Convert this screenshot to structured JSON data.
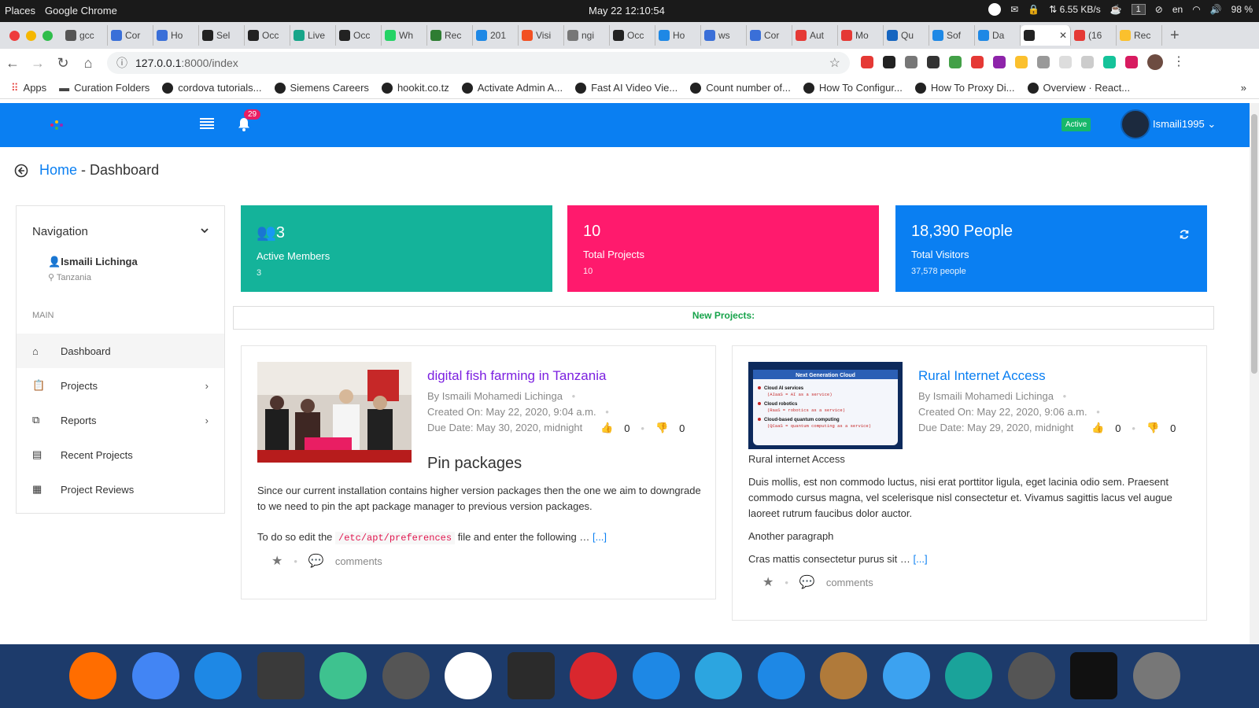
{
  "os": {
    "places": "Places",
    "app": "Google Chrome",
    "clock": "May 22  12:10:54",
    "net": "⇅ 6.55 KB/s",
    "workspace": "1",
    "lang": "en",
    "battery": "98 %"
  },
  "tabs": [
    {
      "label": "gcc",
      "color": "#555"
    },
    {
      "label": "Cor",
      "color": "#3a6fd8"
    },
    {
      "label": "Ho",
      "color": "#3a6fd8"
    },
    {
      "label": "Sel",
      "color": "#222"
    },
    {
      "label": "Occ",
      "color": "#222"
    },
    {
      "label": "Live",
      "color": "#17a589"
    },
    {
      "label": "Occ",
      "color": "#222"
    },
    {
      "label": "Wh",
      "color": "#25d366"
    },
    {
      "label": "Rec",
      "color": "#2e7d32"
    },
    {
      "label": "201",
      "color": "#1e88e5"
    },
    {
      "label": "Visi",
      "color": "#f25022"
    },
    {
      "label": "ngi",
      "color": "#777"
    },
    {
      "label": "Occ",
      "color": "#222"
    },
    {
      "label": "Ho",
      "color": "#1e88e5"
    },
    {
      "label": "ws",
      "color": "#3a6fd8"
    },
    {
      "label": "Cor",
      "color": "#3a6fd8"
    },
    {
      "label": "Aut",
      "color": "#e53935"
    },
    {
      "label": "Mo",
      "color": "#e53935"
    },
    {
      "label": "Qu",
      "color": "#1565c0"
    },
    {
      "label": "Sof",
      "color": "#1e88e5"
    },
    {
      "label": "Da",
      "color": "#1e88e5"
    },
    {
      "label": "",
      "color": "#222",
      "active": true
    },
    {
      "label": "(16",
      "color": "#e53935"
    },
    {
      "label": "Rec",
      "color": "#fbc02d"
    }
  ],
  "address": {
    "host": "127.0.0.1",
    "path": ":8000/index"
  },
  "bookmarks": [
    {
      "label": "Apps"
    },
    {
      "label": "Curation Folders"
    },
    {
      "label": "cordova tutorials..."
    },
    {
      "label": "Siemens Careers"
    },
    {
      "label": "hookit.co.tz"
    },
    {
      "label": "Activate Admin A..."
    },
    {
      "label": "Fast AI Video Vie..."
    },
    {
      "label": "Count number of..."
    },
    {
      "label": "How To Configur..."
    },
    {
      "label": "How To Proxy Di..."
    },
    {
      "label": "Overview · React..."
    }
  ],
  "header": {
    "notifications": "29",
    "status": "Active",
    "username": "Ismaili1995"
  },
  "breadcrumb": {
    "home": "Home",
    "sep": " - ",
    "current": "Dashboard"
  },
  "sidebar": {
    "title": "Navigation",
    "user": "Ismaili Lichinga",
    "location": "Tanzania",
    "section": "MAIN",
    "items": [
      {
        "label": "Dashboard"
      },
      {
        "label": "Projects"
      },
      {
        "label": "Reports"
      },
      {
        "label": "Recent Projects"
      },
      {
        "label": "Project Reviews"
      }
    ]
  },
  "stats": [
    {
      "value": "3",
      "label": "Active Members",
      "sub": "3",
      "color": "#14b39a"
    },
    {
      "value": "10",
      "label": "Total Projects",
      "sub": "10",
      "color": "#ff1a6d"
    },
    {
      "value": "18,390 People",
      "label": "Total Visitors",
      "sub": "37,578 people",
      "color": "#0a7ff2"
    }
  ],
  "new_projects_label": "New Projects:",
  "posts": [
    {
      "title": "digital fish farming in Tanzania",
      "author": "By Ismaili Mohamedi Lichinga",
      "created": "Created On: May 22, 2020, 9:04 a.m.",
      "due": "Due Date: May 30, 2020, midnight",
      "likes": "0",
      "dislikes": "0",
      "heading": "Pin packages",
      "para1": "Since our current installation contains higher version packages then the one we aim to downgrade to we need to pin the apt package manager to previous version packages.",
      "para2_a": "To do so edit the",
      "code": "/etc/apt/preferences",
      "para2_b": "file and enter the following …",
      "more": "[...]",
      "comments": "comments"
    },
    {
      "title": "Rural Internet Access",
      "author": "By Ismaili Mohamedi Lichinga",
      "created": "Created On: May 22, 2020, 9:06 a.m.",
      "due": "Due Date: May 29, 2020, midnight",
      "likes": "0",
      "dislikes": "0",
      "caption": "Rural internet Access",
      "para1": "Duis mollis, est non commodo luctus, nisi erat porttitor ligula, eget lacinia odio sem. Praesent commodo cursus magna, vel scelerisque nisl consectetur et. Vivamus sagittis lacus vel augue laoreet rutrum faucibus dolor auctor.",
      "para2": "Another paragraph",
      "para3": "Cras mattis consectetur purus sit …",
      "more": "[...]",
      "comments": "comments",
      "image_text": {
        "title": "Next Generation Cloud",
        "l1": "Cloud AI services",
        "l1b": "(AIaaS = AI as a service)",
        "l2": "Cloud robotics",
        "l2b": "(RaaS = robotics as a service)",
        "l3": "Cloud-based quantum computing",
        "l3b": "(QCaaS = quantum computing as a service)"
      }
    }
  ],
  "dock": [
    {
      "name": "firefox",
      "color": "#ff6d00"
    },
    {
      "name": "chrome",
      "color": "#4285f4"
    },
    {
      "name": "vscode",
      "color": "#1e88e5"
    },
    {
      "name": "sublime",
      "color": "#3a3a3a"
    },
    {
      "name": "atom",
      "color": "#3ec28f"
    },
    {
      "name": "xampp",
      "color": "#555"
    },
    {
      "name": "slack",
      "color": "#fff"
    },
    {
      "name": "terminal",
      "color": "#2b2b2b"
    },
    {
      "name": "mega",
      "color": "#d9272e"
    },
    {
      "name": "messages",
      "color": "#1e88e5"
    },
    {
      "name": "telegram",
      "color": "#2ca5e0"
    },
    {
      "name": "appstore",
      "color": "#1e88e5"
    },
    {
      "name": "contacts",
      "color": "#b07a3a"
    },
    {
      "name": "finder",
      "color": "#3ca2f0"
    },
    {
      "name": "stats",
      "color": "#1aa39a"
    },
    {
      "name": "disk",
      "color": "#555"
    },
    {
      "name": "dev",
      "color": "#111"
    },
    {
      "name": "launcher",
      "color": "#777"
    }
  ]
}
